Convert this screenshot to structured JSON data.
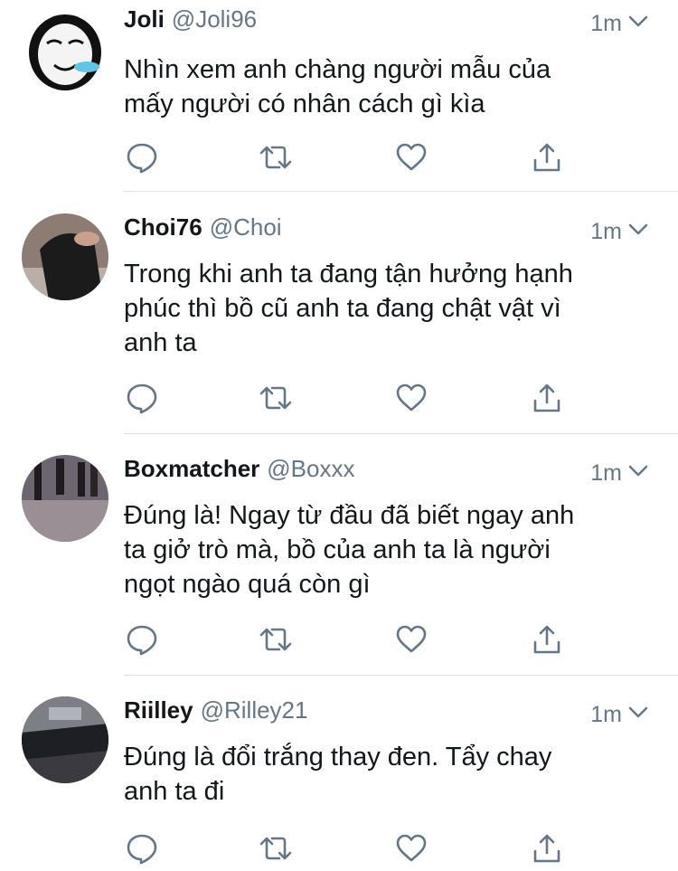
{
  "tweets": [
    {
      "name": "Joli",
      "handle": "@Joli96",
      "time": "1m",
      "text": [
        "Nhìn xem anh chàng người mẫu của",
        "mấy người có nhân cách gì kìa"
      ]
    },
    {
      "name": "Choi76",
      "handle": "@Choi",
      "time": "1m",
      "text": [
        "Trong khi anh ta đang tận hưởng hạnh",
        "phúc thì bồ cũ anh ta đang chật vật vì",
        "anh ta"
      ]
    },
    {
      "name": "Boxmatcher",
      "handle": "@Boxxx",
      "time": "1m",
      "text": [
        "Đúng là! Ngay từ đầu đã biết ngay anh",
        "ta giở trò mà, bồ của anh ta là người",
        "ngọt ngào quá còn gì"
      ]
    },
    {
      "name": "Riilley",
      "handle": "@Rilley21",
      "time": "1m",
      "text": [
        "Đúng là đổi trắng thay đen. Tẩy chay",
        "anh ta đi"
      ]
    }
  ],
  "icons": {
    "reply": "reply-icon",
    "retweet": "retweet-icon",
    "like": "heart-icon",
    "share": "share-icon",
    "more": "chevron-down-icon"
  },
  "colors": {
    "icon": "#657786",
    "divider": "#dcdfe3",
    "text": "#14171a"
  }
}
